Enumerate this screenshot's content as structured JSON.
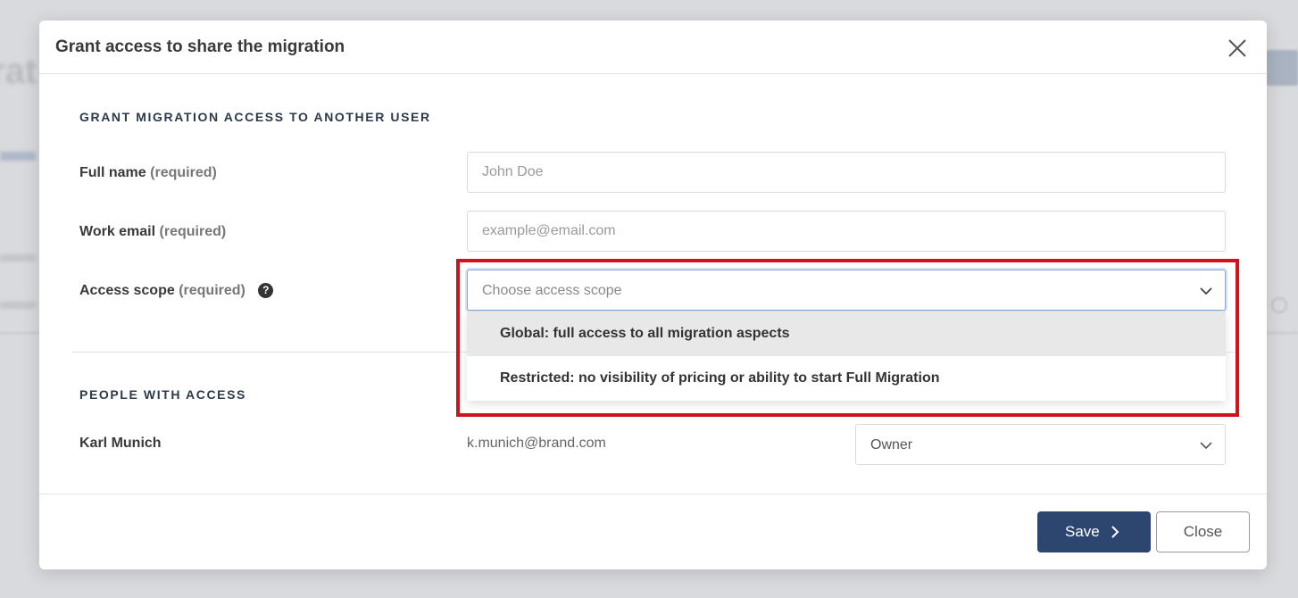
{
  "modal": {
    "title": "Grant access to share the migration"
  },
  "grant_section": {
    "heading": "GRANT MIGRATION ACCESS TO ANOTHER USER",
    "full_name": {
      "label": "Full name",
      "req": "(required)",
      "placeholder": "John Doe"
    },
    "work_email": {
      "label": "Work email",
      "req": "(required)",
      "placeholder": "example@email.com"
    },
    "access_scope": {
      "label": "Access scope",
      "req": "(required)",
      "help_glyph": "?",
      "placeholder": "Choose access scope",
      "options": [
        "Global: full access to all migration aspects",
        "Restricted: no visibility of pricing or ability to start Full Migration"
      ]
    }
  },
  "people_section": {
    "heading": "PEOPLE WITH ACCESS",
    "people": [
      {
        "name": "Karl Munich",
        "email": "k.munich@brand.com",
        "role": "Owner"
      }
    ]
  },
  "footer": {
    "save_label": "Save",
    "close_label": "Close"
  },
  "colors": {
    "primary": "#2d4670",
    "highlight": "#d4101a"
  }
}
